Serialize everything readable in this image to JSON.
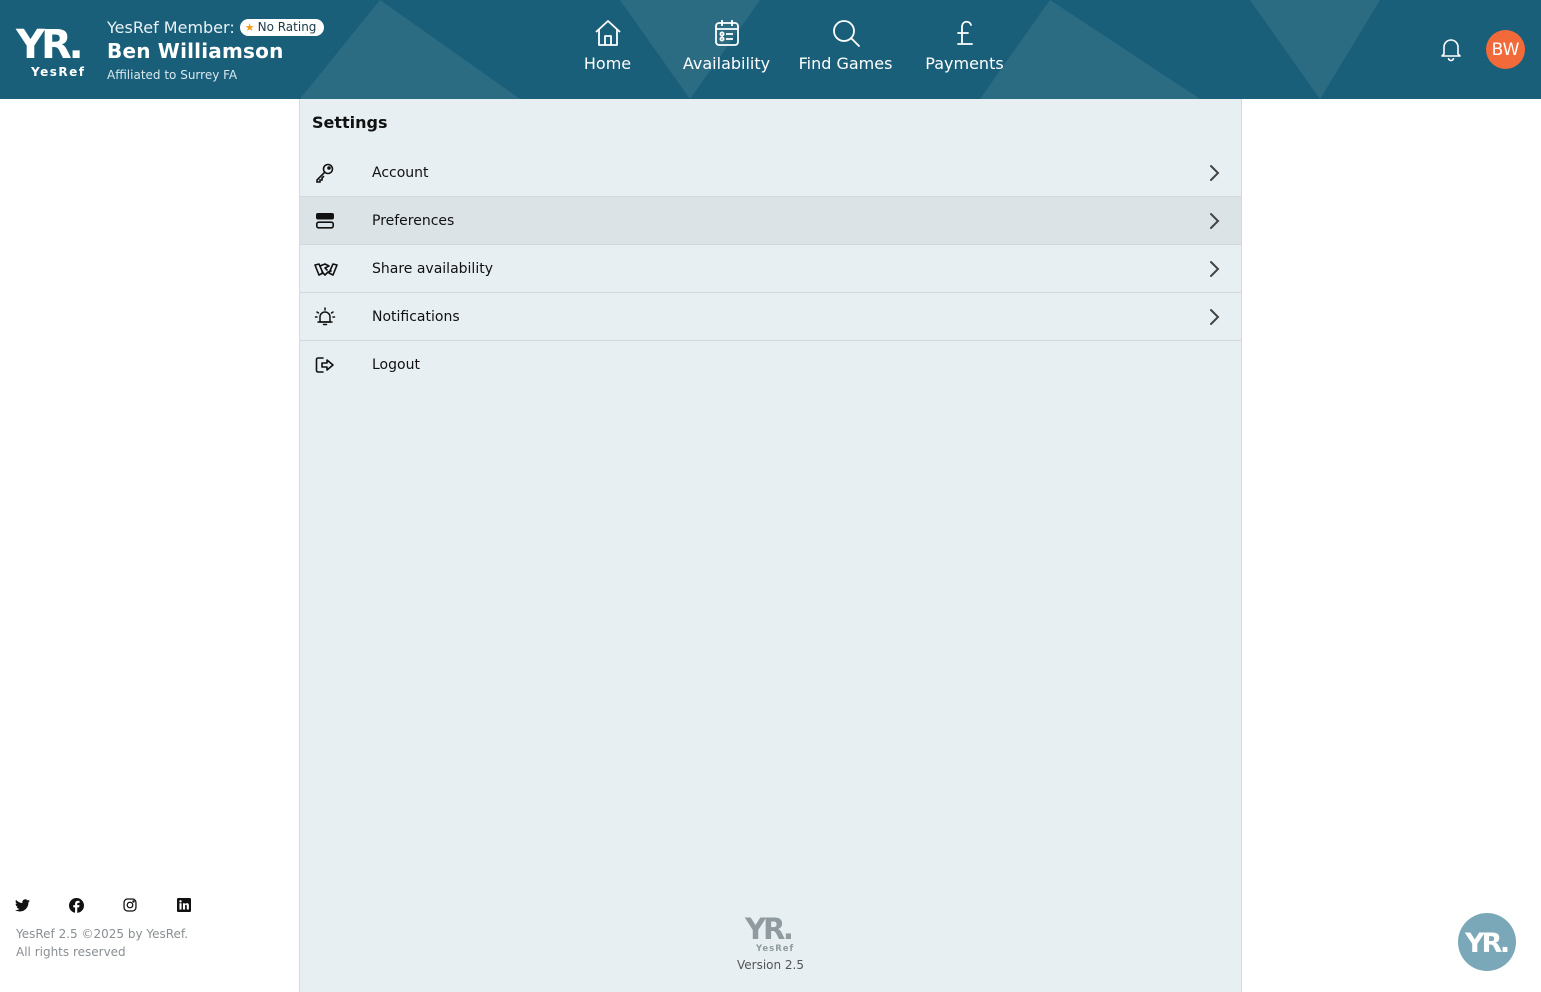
{
  "header": {
    "logo_text": "YR.",
    "logo_subtext": "YesRef",
    "member_label": "YesRef Member:",
    "rating_badge": "No Rating",
    "member_name": "Ben Williamson",
    "affiliation": "Affiliated to Surrey FA",
    "nav": [
      {
        "label": "Home",
        "icon": "home-icon"
      },
      {
        "label": "Availability",
        "icon": "calendar-icon"
      },
      {
        "label": "Find Games",
        "icon": "search-icon"
      },
      {
        "label": "Payments",
        "icon": "pound-icon"
      }
    ],
    "avatar_initials": "BW"
  },
  "settings": {
    "title": "Settings",
    "items": [
      {
        "label": "Account",
        "icon": "key-icon",
        "has_chevron": true
      },
      {
        "label": "Preferences",
        "icon": "preferences-icon",
        "has_chevron": true
      },
      {
        "label": "Share availability",
        "icon": "handshake-icon",
        "has_chevron": true
      },
      {
        "label": "Notifications",
        "icon": "alarm-bell-icon",
        "has_chevron": true
      },
      {
        "label": "Logout",
        "icon": "logout-icon",
        "has_chevron": false
      }
    ],
    "version": "Version 2.5"
  },
  "footer": {
    "social": [
      "twitter-icon",
      "facebook-icon",
      "instagram-icon",
      "linkedin-icon"
    ],
    "copyright_line1": "YesRef 2.5 ©2025 by YesRef.",
    "copyright_line2": "All rights reserved"
  },
  "colors": {
    "header_bg": "#1a5f79",
    "panel_bg": "#e7eff2",
    "avatar_bg": "#f26a3a",
    "rating_star": "#f29a1c",
    "fab_bg": "#7ba8b8"
  }
}
